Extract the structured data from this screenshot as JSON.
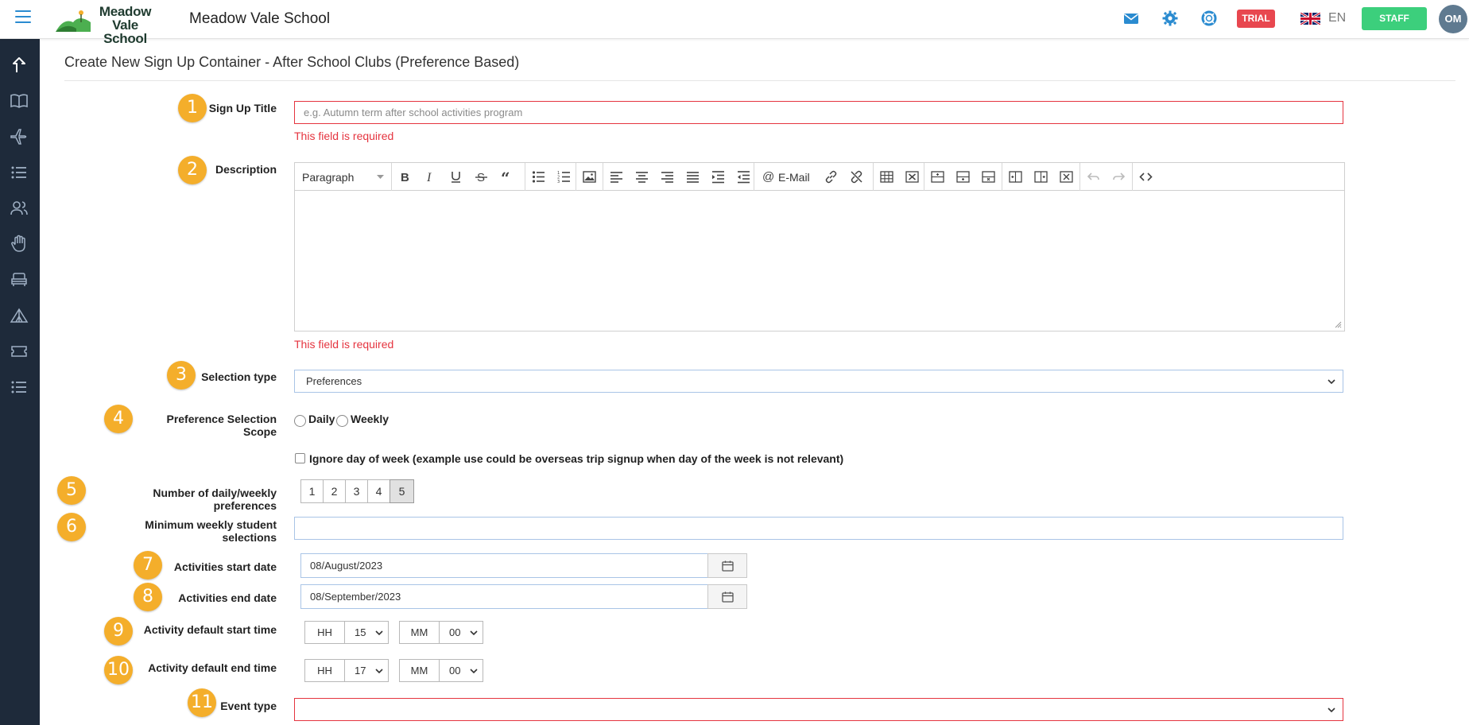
{
  "header": {
    "school_name_line1": "Meadow",
    "school_name_line2": "Vale School",
    "app_title": "Meadow Vale School",
    "trial_label": "TRIAL",
    "language": "EN",
    "staff_label": "STAFF",
    "avatar_initials": "OM"
  },
  "page": {
    "title": "Create New Sign Up Container - After School Clubs (Preference Based)"
  },
  "form": {
    "sign_up_title": {
      "badge": "1",
      "label": "Sign Up Title",
      "placeholder": "e.g. Autumn term after school activities program",
      "error": "This field is required"
    },
    "description": {
      "badge": "2",
      "label": "Description",
      "error": "This field is required",
      "toolbar": {
        "block_format": "Paragraph",
        "email_label": "E-Mail"
      }
    },
    "selection_type": {
      "badge": "3",
      "label": "Selection type",
      "value": "Preferences"
    },
    "preference_scope": {
      "badge": "4",
      "label": "Preference Selection Scope",
      "options": [
        "Daily",
        "Weekly"
      ]
    },
    "ignore_day_of_week": {
      "label": "Ignore day of week (example use could be overseas trip signup when day of the week is not relevant)"
    },
    "num_preferences": {
      "badge": "5",
      "label": "Number of daily/weekly preferences",
      "options": [
        "1",
        "2",
        "3",
        "4",
        "5"
      ],
      "selected": "5"
    },
    "min_weekly": {
      "badge": "6",
      "label": "Minimum weekly student selections",
      "value": ""
    },
    "start_date": {
      "badge": "7",
      "label": "Activities start date",
      "value": "08/August/2023"
    },
    "end_date": {
      "badge": "8",
      "label": "Activities end date",
      "value": "08/September/2023"
    },
    "default_start_time": {
      "badge": "9",
      "label": "Activity default start time",
      "hh_label": "HH",
      "hh_value": "15",
      "mm_label": "MM",
      "mm_value": "00"
    },
    "default_end_time": {
      "badge": "10",
      "label": "Activity default end time",
      "hh_label": "HH",
      "hh_value": "17",
      "mm_label": "MM",
      "mm_value": "00"
    },
    "event_type": {
      "badge": "11",
      "label": "Event type",
      "value": ""
    }
  },
  "colors": {
    "accent_badge": "#f4ae2b",
    "error": "#e5343f",
    "trial": "#e8474f",
    "staff": "#3ccf7c",
    "sidebar": "#1e2a3a",
    "top_icons": "#2a8bd0"
  }
}
